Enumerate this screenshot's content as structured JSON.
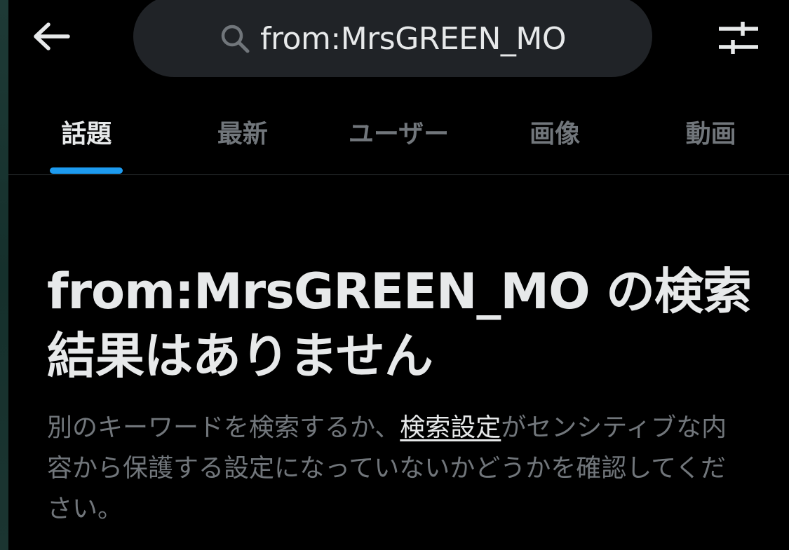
{
  "header": {
    "back_icon": "arrow-left-icon",
    "search_icon": "search-icon",
    "search_query": "from:MrsGREEN_MO",
    "filter_icon": "sliders-icon"
  },
  "tabs": [
    {
      "label": "話題",
      "active": true
    },
    {
      "label": "最新",
      "active": false
    },
    {
      "label": "ユーザー",
      "active": false
    },
    {
      "label": "画像",
      "active": false
    },
    {
      "label": "動画",
      "active": false
    }
  ],
  "empty_state": {
    "title": "from:MrsGREEN_MO の検索結果はありません",
    "desc_before": "別のキーワードを検索するか、",
    "desc_link": "検索設定",
    "desc_after": "がセンシティブな内容から保護する設定になっていないかどうかを確認してください。"
  },
  "colors": {
    "background": "#000000",
    "search_pill": "#202327",
    "text_primary": "#e7e9ea",
    "text_secondary": "#71767b",
    "accent": "#1d9bf0",
    "divider": "#2f3336"
  }
}
